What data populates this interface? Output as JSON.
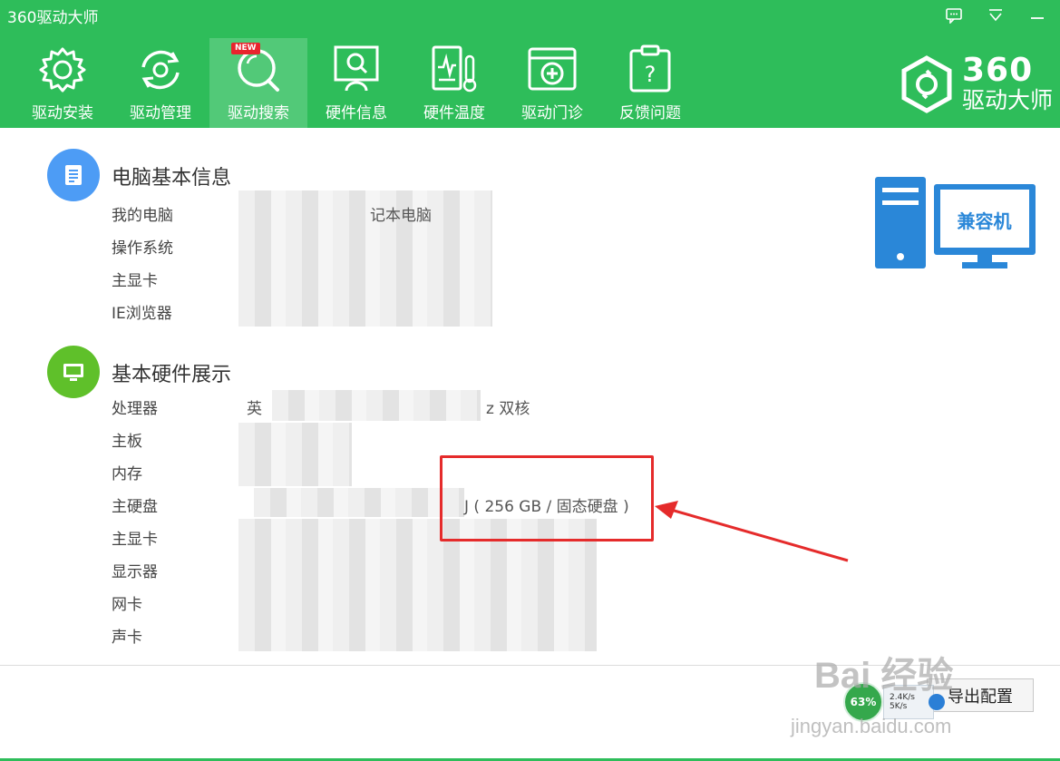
{
  "window": {
    "title": "360驱动大师"
  },
  "nav": {
    "items": [
      {
        "label": "驱动安装",
        "icon": "gear-icon"
      },
      {
        "label": "驱动管理",
        "icon": "refresh-gear-icon"
      },
      {
        "label": "驱动搜索",
        "icon": "search-icon",
        "badge": "NEW",
        "active": true
      },
      {
        "label": "硬件信息",
        "icon": "monitor-search-icon"
      },
      {
        "label": "硬件温度",
        "icon": "thermometer-icon"
      },
      {
        "label": "驱动门诊",
        "icon": "clinic-icon"
      },
      {
        "label": "反馈问题",
        "icon": "feedback-icon"
      }
    ]
  },
  "brand": {
    "number": "360",
    "name": "驱动大师"
  },
  "basic_info": {
    "title": "电脑基本信息",
    "rows": [
      {
        "label": "我的电脑",
        "value": "记本电脑"
      },
      {
        "label": "操作系统",
        "value": ""
      },
      {
        "label": "主显卡",
        "value": ""
      },
      {
        "label": "IE浏览器",
        "value": ""
      }
    ]
  },
  "hardware": {
    "title": "基本硬件展示",
    "rows": [
      {
        "label": "处理器",
        "value": "z 双核"
      },
      {
        "label": "主板",
        "value": ""
      },
      {
        "label": "内存",
        "value": ""
      },
      {
        "label": "主硬盘",
        "value": "J ( 256 GB / 固态硬盘 )"
      },
      {
        "label": "主显卡",
        "value": ""
      },
      {
        "label": "显示器",
        "value": ""
      },
      {
        "label": "网卡",
        "value": ""
      },
      {
        "label": "声卡",
        "value": ""
      }
    ],
    "cpu_prefix": "英"
  },
  "compat": {
    "label": "兼容机"
  },
  "footer": {
    "button_label": "导出配置"
  },
  "speed_widget": {
    "percent": "63%",
    "up": "2.4K/s",
    "down": "5K/s"
  },
  "watermark": {
    "main": "Bai 经验",
    "sub": "jingyan.baidu.com"
  },
  "colors": {
    "header": "#2ebd5a",
    "active_nav": "#52c978",
    "info_icon": "#4d9cf5",
    "hw_icon": "#5fc02a",
    "highlight": "#e52b2b",
    "compat_blue": "#2a87d8"
  }
}
